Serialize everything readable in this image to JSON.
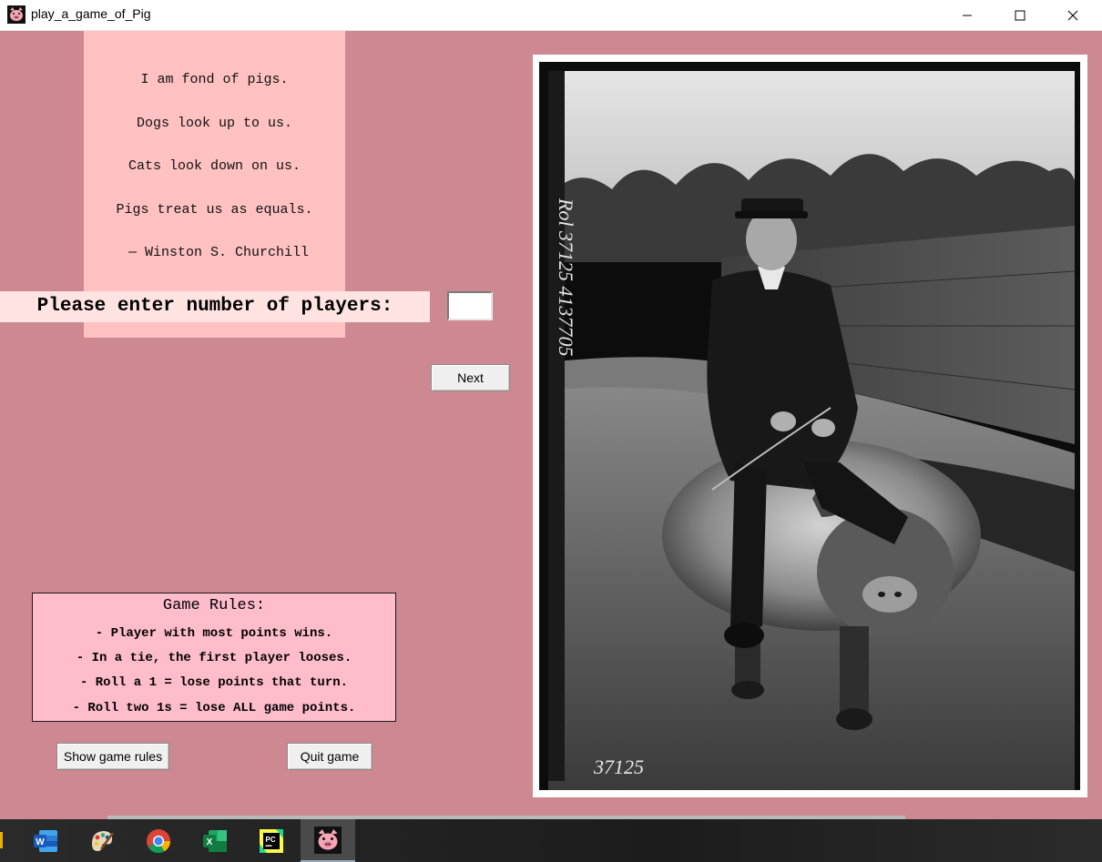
{
  "window": {
    "title": "play_a_game_of_Pig",
    "app_icon": "pig-face-icon",
    "controls": [
      "minimize-icon",
      "maximize-icon",
      "close-icon"
    ]
  },
  "quote": {
    "lines": [
      "I am fond of pigs.",
      "Dogs look up to us.",
      "Cats look down on us.",
      "Pigs treat us as equals.",
      " — Winston S. Churchill"
    ]
  },
  "players": {
    "label": "Please enter number of players:",
    "value": ""
  },
  "buttons": {
    "next": "Next",
    "show_rules": "Show game rules",
    "quit": "Quit game"
  },
  "rules": {
    "title": "Game Rules:",
    "lines": [
      "- Player with most points wins.",
      "- In a tie, the first player looses.",
      "- Roll a 1 = lose points that turn.",
      "- Roll two 1s = lose ALL game points."
    ]
  },
  "photo": {
    "side_caption": "Rol 37125 4137705",
    "bottom_caption": "37125"
  },
  "taskbar": {
    "items": [
      "word-icon",
      "paint-icon",
      "chrome-icon",
      "excel-icon",
      "pycharm-icon",
      "pig-game-icon"
    ]
  },
  "colors": {
    "background": "#cd8892",
    "quote_panel": "#ffc1c1",
    "rules_box": "#ffbccb",
    "label_bg": "#ffe4e1"
  }
}
